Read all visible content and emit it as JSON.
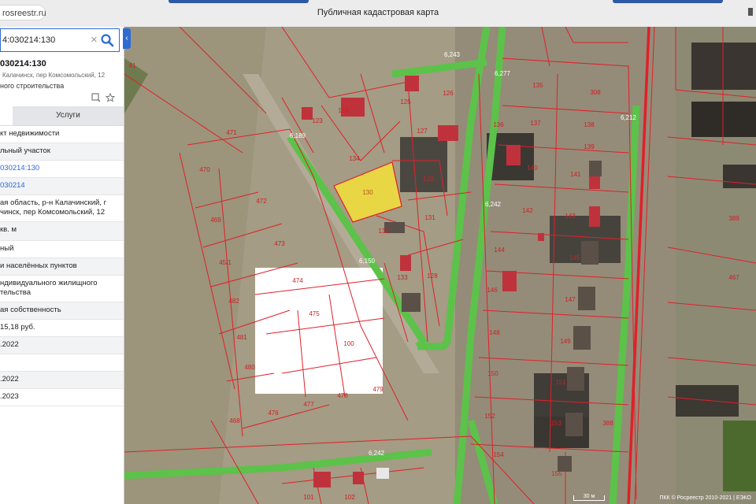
{
  "browser": {
    "url": "rosreestr.ru",
    "title": "Публичная кадастровая карта"
  },
  "search": {
    "value": "4:030214:130"
  },
  "object": {
    "title": "030214:130",
    "address": "Калачинск, пер Комсомольский, 12",
    "purpose": "ного строительства"
  },
  "tabs": {
    "services": "Услуги"
  },
  "attributes": [
    "кт недвижимости",
    "льный участок",
    "030214:130",
    "030214",
    "ая область, р-н Калачинский, г\nчинск, пер Комсомольский, 12",
    "кв. м",
    "ный",
    "и населённых пунктов",
    "ндивидуального жилищного\nтельства",
    "ая собственность",
    "15,18 руб.",
    ".2022",
    "",
    ".2022",
    ".2023"
  ],
  "map": {
    "attribution": "ПКК © Росреестр 2010-2021 | ЕЭКО",
    "scale_label": "30 м",
    "highlight_color": "#f5e13a",
    "boundary_color": "#e0202a",
    "road_color": "#5cc24a",
    "parcel_labels": [
      "41",
      "130",
      "123",
      "124",
      "125",
      "126",
      "127",
      "129",
      "131",
      "132",
      "133",
      "134",
      "128",
      "135",
      "136",
      "137",
      "138",
      "139",
      "140",
      "141",
      "142",
      "143",
      "144",
      "145",
      "146",
      "147",
      "148",
      "149",
      "150",
      "151",
      "152",
      "153",
      "154",
      "155",
      "308",
      "388",
      "389",
      "467",
      "468",
      "469",
      "470",
      "471",
      "472",
      "473",
      "474",
      "475",
      "476",
      "477",
      "478",
      "479",
      "480",
      "481",
      "482",
      "45/1",
      "100",
      "101",
      "102"
    ],
    "road_labels": [
      "6,243",
      "6,277",
      "6,189",
      "6,150",
      "6,242",
      "6,212",
      "6,242"
    ]
  }
}
